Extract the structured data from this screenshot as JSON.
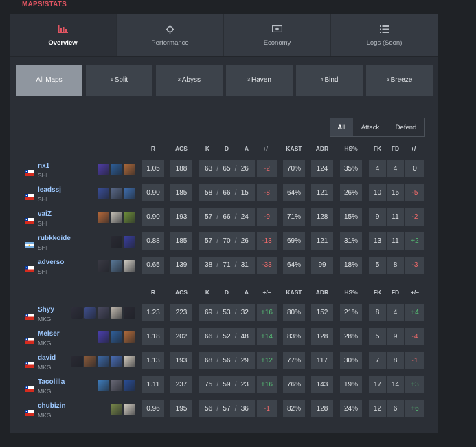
{
  "section_title": "MAPS/STATS",
  "tabs": [
    {
      "label": "Overview",
      "icon": "bar-chart-icon",
      "active": true
    },
    {
      "label": "Performance",
      "icon": "crosshair-icon",
      "active": false
    },
    {
      "label": "Economy",
      "icon": "money-icon",
      "active": false
    },
    {
      "label": "Logs (Soon)",
      "icon": "list-icon",
      "active": false
    }
  ],
  "maps": [
    {
      "num": "",
      "label": "All Maps",
      "active": true
    },
    {
      "num": "1",
      "label": "Split",
      "active": false
    },
    {
      "num": "2",
      "label": "Abyss",
      "active": false
    },
    {
      "num": "3",
      "label": "Haven",
      "active": false
    },
    {
      "num": "4",
      "label": "Bind",
      "active": false
    },
    {
      "num": "5",
      "label": "Breeze",
      "active": false
    }
  ],
  "side_filter": [
    {
      "label": "All",
      "active": true
    },
    {
      "label": "Attack",
      "active": false
    },
    {
      "label": "Defend",
      "active": false
    }
  ],
  "headers": {
    "r": "R",
    "acs": "ACS",
    "k": "K",
    "d": "D",
    "a": "A",
    "pm": "+/–",
    "kast": "KAST",
    "adr": "ADR",
    "hs": "HS%",
    "fk": "FK",
    "fd": "FD",
    "fpm": "+/–"
  },
  "teams": [
    {
      "players": [
        {
          "name": "nx1",
          "team": "SHI",
          "flag": "chile",
          "agents": [
            "#4f3da8",
            "#2e5f9a",
            "#b06a3a"
          ],
          "r": "1.05",
          "acs": "188",
          "k": "63",
          "d": "65",
          "a": "26",
          "pm": "-2",
          "kast": "70%",
          "adr": "124",
          "hs": "35%",
          "fk": "4",
          "fd": "4",
          "fpm": "0"
        },
        {
          "name": "leadssj",
          "team": "SHI",
          "flag": "chile",
          "agents": [
            "#3a4f9a",
            "#5a6a8a",
            "#3f6fb0"
          ],
          "r": "0.90",
          "acs": "185",
          "k": "58",
          "d": "66",
          "a": "15",
          "pm": "-8",
          "kast": "64%",
          "adr": "121",
          "hs": "26%",
          "fk": "10",
          "fd": "15",
          "fpm": "-5"
        },
        {
          "name": "vaiZ",
          "team": "SHI",
          "flag": "chile",
          "agents": [
            "#b86a3a",
            "#c7c2b8",
            "#6f8f3a"
          ],
          "r": "0.90",
          "acs": "193",
          "k": "57",
          "d": "66",
          "a": "24",
          "pm": "-9",
          "kast": "71%",
          "adr": "128",
          "hs": "15%",
          "fk": "9",
          "fd": "11",
          "fpm": "-2"
        },
        {
          "name": "rubkkoide",
          "team": "SHI",
          "flag": "argentina",
          "agents": [
            "#2a2a33",
            "#3a3fa0"
          ],
          "r": "0.88",
          "acs": "185",
          "k": "57",
          "d": "70",
          "a": "26",
          "pm": "-13",
          "kast": "69%",
          "adr": "121",
          "hs": "31%",
          "fk": "13",
          "fd": "11",
          "fpm": "+2"
        },
        {
          "name": "adverso",
          "team": "SHI",
          "flag": "chile",
          "agents": [
            "#3a3a44",
            "#5a7a9a",
            "#d3cfc6"
          ],
          "r": "0.65",
          "acs": "139",
          "k": "38",
          "d": "71",
          "a": "31",
          "pm": "-33",
          "kast": "64%",
          "adr": "99",
          "hs": "18%",
          "fk": "5",
          "fd": "8",
          "fpm": "-3"
        }
      ]
    },
    {
      "players": [
        {
          "name": "Shyy",
          "team": "MKG",
          "flag": "chile",
          "agents": [
            "#2e2e3a",
            "#3e4d8a",
            "#4a4a60",
            "#c0b8ae",
            "#2a2a33"
          ],
          "r": "1.23",
          "acs": "223",
          "k": "69",
          "d": "53",
          "a": "32",
          "pm": "+16",
          "kast": "80%",
          "adr": "152",
          "hs": "21%",
          "fk": "8",
          "fd": "4",
          "fpm": "+4"
        },
        {
          "name": "Melser",
          "team": "MKG",
          "flag": "chile",
          "agents": [
            "#4a3fae",
            "#2f5f9a",
            "#b06a3a"
          ],
          "r": "1.18",
          "acs": "202",
          "k": "66",
          "d": "52",
          "a": "48",
          "pm": "+14",
          "kast": "83%",
          "adr": "128",
          "hs": "28%",
          "fk": "5",
          "fd": "9",
          "fpm": "-4"
        },
        {
          "name": "david",
          "team": "MKG",
          "flag": "chile",
          "agents": [
            "#2a2a33",
            "#8a5a3a",
            "#3e6aa8",
            "#4a6fb8",
            "#d8d0c2"
          ],
          "r": "1.13",
          "acs": "193",
          "k": "68",
          "d": "56",
          "a": "29",
          "pm": "+12",
          "kast": "77%",
          "adr": "117",
          "hs": "30%",
          "fk": "7",
          "fd": "8",
          "fpm": "-1"
        },
        {
          "name": "Tacolilla",
          "team": "MKG",
          "flag": "chile",
          "agents": [
            "#3f7fc0",
            "#6a6a78",
            "#2a4f9a"
          ],
          "r": "1.11",
          "acs": "237",
          "k": "75",
          "d": "59",
          "a": "23",
          "pm": "+16",
          "kast": "76%",
          "adr": "143",
          "hs": "19%",
          "fk": "17",
          "fd": "14",
          "fpm": "+3"
        },
        {
          "name": "chubizin",
          "team": "MKG",
          "flag": "chile",
          "agents": [
            "#7a8a4a",
            "#d6d0c4"
          ],
          "r": "0.96",
          "acs": "195",
          "k": "56",
          "d": "57",
          "a": "36",
          "pm": "-1",
          "kast": "82%",
          "adr": "128",
          "hs": "24%",
          "fk": "12",
          "fd": "6",
          "fpm": "+6"
        }
      ]
    }
  ]
}
